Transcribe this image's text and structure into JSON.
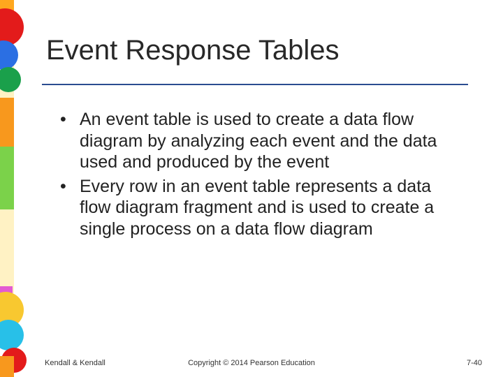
{
  "title": "Event Response Tables",
  "bullets": [
    "An event table is used to create a data flow diagram by analyzing each event and the data used and produced by the event",
    "Every row in an event table represents a data flow diagram fragment and is used to create a single process on a data flow diagram"
  ],
  "footer": {
    "left": "Kendall & Kendall",
    "center": "Copyright © 2014 Pearson Education",
    "right": "7-40"
  }
}
